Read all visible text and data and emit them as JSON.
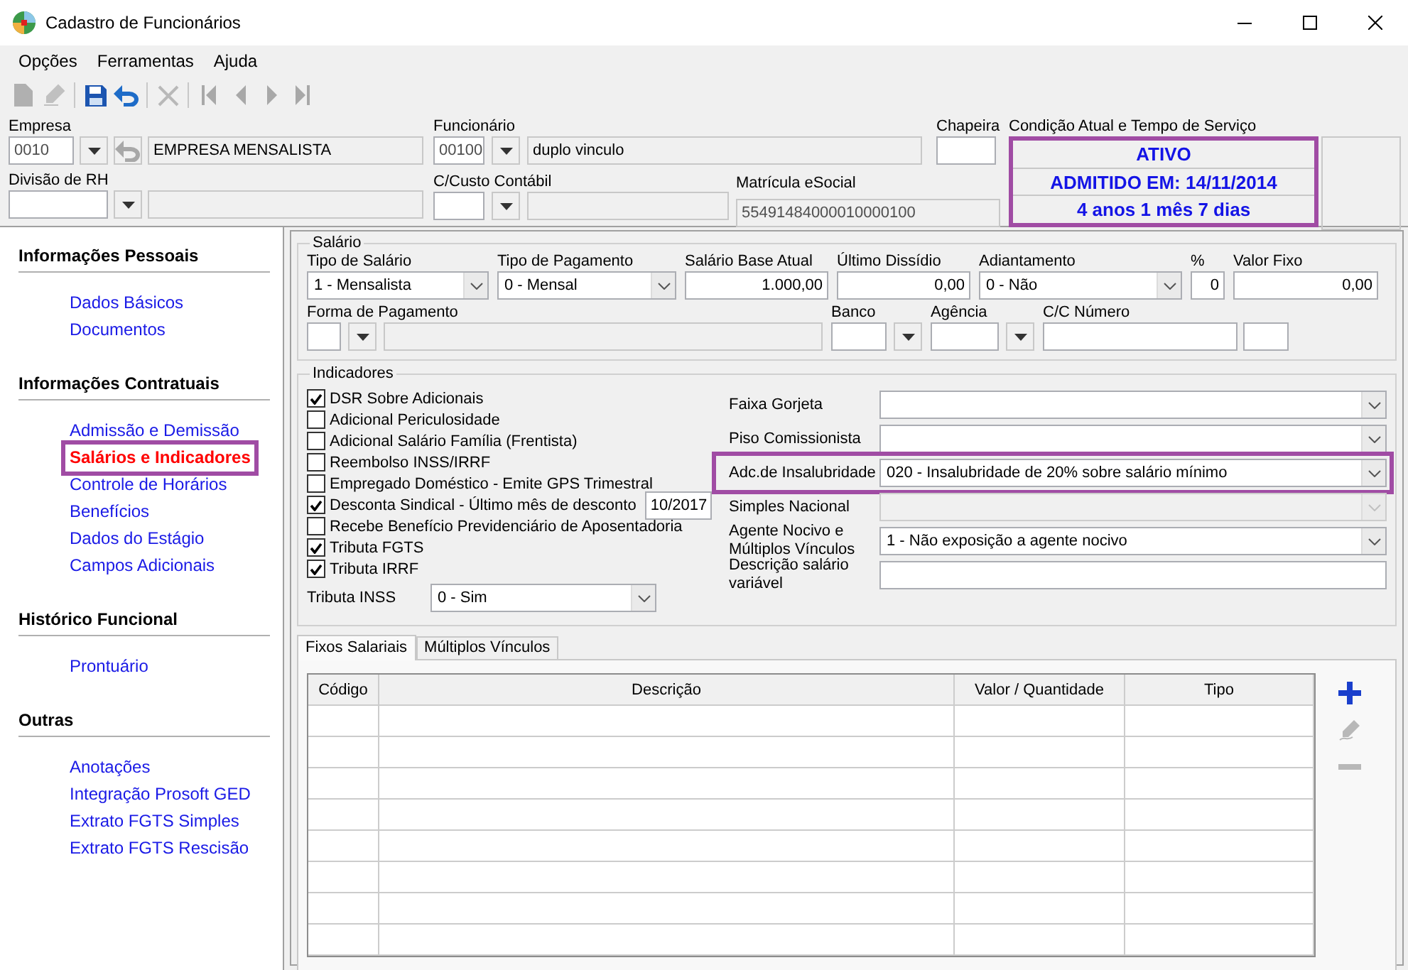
{
  "window": {
    "title": "Cadastro de Funcionários"
  },
  "menu": [
    {
      "label": "Opções"
    },
    {
      "label": "Ferramentas"
    },
    {
      "label": "Ajuda"
    }
  ],
  "toolbar_groups": [
    {
      "buttons": [
        {
          "kind": "new",
          "disabled": true
        },
        {
          "kind": "edit",
          "disabled": true
        }
      ]
    },
    {
      "buttons": [
        {
          "kind": "save",
          "disabled": false
        },
        {
          "kind": "undo",
          "disabled": false
        }
      ]
    },
    {
      "buttons": [
        {
          "kind": "delete",
          "disabled": true
        }
      ]
    },
    {
      "buttons": [
        {
          "kind": "first",
          "disabled": true
        },
        {
          "kind": "prev",
          "disabled": true
        },
        {
          "kind": "next",
          "disabled": true
        },
        {
          "kind": "last",
          "disabled": true
        }
      ]
    }
  ],
  "header": {
    "empresa": {
      "label": "Empresa",
      "code": "0010",
      "name": "EMPRESA MENSALISTA"
    },
    "funcionario": {
      "label": "Funcionário",
      "code": "00100",
      "name": "duplo vinculo"
    },
    "chapeira": {
      "label": "Chapeira"
    },
    "divisao": {
      "label": "Divisão de RH"
    },
    "ccusto": {
      "label": "C/Custo Contábil"
    },
    "matricula": {
      "label": "Matrícula eSocial",
      "value": "55491484000010000100"
    },
    "condicao": {
      "label": "Condição Atual e Tempo de Serviço",
      "lines": [
        "ATIVO",
        "ADMITIDO EM: 14/11/2014",
        "4 anos 1 mês 7 dias"
      ]
    }
  },
  "sidebar": {
    "sections": [
      {
        "title": "Informações Pessoais",
        "items": [
          {
            "label": "Dados Básicos",
            "selected": false
          },
          {
            "label": "Documentos",
            "selected": false
          }
        ]
      },
      {
        "title": "Informações Contratuais",
        "items": [
          {
            "label": "Admissão e Demissão",
            "selected": false
          },
          {
            "label": "Salários e Indicadores",
            "selected": true
          },
          {
            "label": "Controle de Horários",
            "selected": false
          },
          {
            "label": "Benefícios",
            "selected": false
          },
          {
            "label": "Dados do Estágio",
            "selected": false
          },
          {
            "label": "Campos Adicionais",
            "selected": false
          }
        ]
      },
      {
        "title": "Histórico Funcional",
        "items": [
          {
            "label": "Prontuário",
            "selected": false
          }
        ]
      },
      {
        "title": "Outras",
        "items": [
          {
            "label": "Anotações",
            "selected": false
          },
          {
            "label": "Integração Prosoft GED",
            "selected": false
          },
          {
            "label": "Extrato FGTS Simples",
            "selected": false
          },
          {
            "label": "Extrato FGTS Rescisão",
            "selected": false
          }
        ]
      }
    ]
  },
  "salario": {
    "legend": "Salário",
    "row_1": [
      {
        "kind": "combo",
        "label": "Tipo de Salário",
        "value": "1 - Mensalista"
      },
      {
        "kind": "combo",
        "label": "Tipo de Pagamento",
        "value": "0 - Mensal"
      },
      {
        "kind": "number",
        "label": "Salário Base Atual",
        "value": "1.000,00"
      },
      {
        "kind": "number",
        "label": "Último Dissídio",
        "value": "0,00"
      },
      {
        "kind": "combo",
        "label": "Adiantamento",
        "value": "0 - Não"
      },
      {
        "kind": "number",
        "label": "%",
        "value": "0"
      },
      {
        "kind": "number",
        "label": "Valor Fixo",
        "value": "0,00"
      }
    ],
    "row_2": [
      {
        "kind": "lookup",
        "label": "Forma de Pagamento"
      },
      {
        "kind": "picker",
        "label": "Banco"
      },
      {
        "kind": "picker",
        "label": "Agência"
      },
      {
        "kind": "account",
        "label": "C/C Número"
      }
    ]
  },
  "indicadores": {
    "legend": "Indicadores",
    "checks": [
      {
        "label": "DSR Sobre Adicionais",
        "checked": true
      },
      {
        "label": "Adicional Periculosidade",
        "checked": false
      },
      {
        "label": "Adicional Salário Família (Frentista)",
        "checked": false
      },
      {
        "label": "Reembolso INSS/IRRF",
        "checked": false
      },
      {
        "label": "Empregado Doméstico - Emite GPS Trimestral",
        "checked": false
      },
      {
        "label": "Desconta Sindical - Último mês de desconto",
        "checked": true,
        "value": "10/2017"
      },
      {
        "label": "Recebe Benefício Previdenciário de Aposentadoria",
        "checked": false
      },
      {
        "label": "Tributa FGTS",
        "checked": true
      },
      {
        "label": "Tributa IRRF",
        "checked": true
      }
    ],
    "inss": {
      "label": "Tributa INSS",
      "value": "0 - Sim"
    },
    "fields": [
      {
        "kind": "combo",
        "label": "Faixa Gorjeta",
        "disabled": false,
        "highlighted": false
      },
      {
        "kind": "combo",
        "label": "Piso Comissionista",
        "disabled": false,
        "highlighted": false
      },
      {
        "kind": "combo",
        "label": "Adc.de Insalubridade",
        "value": "020 - Insalubridade de 20% sobre salário mínimo",
        "disabled": false,
        "highlighted": true
      },
      {
        "kind": "combo",
        "label": "Simples Nacional",
        "disabled": true,
        "highlighted": false
      },
      {
        "kind": "combo",
        "label": "Agente Nocivo e Múltiplos Vínculos",
        "value": "1 - Não exposição a agente nocivo",
        "disabled": false,
        "highlighted": false
      },
      {
        "kind": "text",
        "label": "Descrição salário variável",
        "disabled": false,
        "highlighted": false
      }
    ]
  },
  "tabs": [
    {
      "label": "Fixos Salariais",
      "selected": true
    },
    {
      "label": "Múltiplos Vínculos",
      "selected": false
    }
  ],
  "table": {
    "columns": [
      "Código",
      "Descrição",
      "Valor / Quantidade",
      "Tipo"
    ]
  },
  "table_actions": [
    {
      "kind": "add",
      "disabled": false
    },
    {
      "kind": "edit",
      "disabled": true
    },
    {
      "kind": "remove",
      "disabled": true
    }
  ]
}
